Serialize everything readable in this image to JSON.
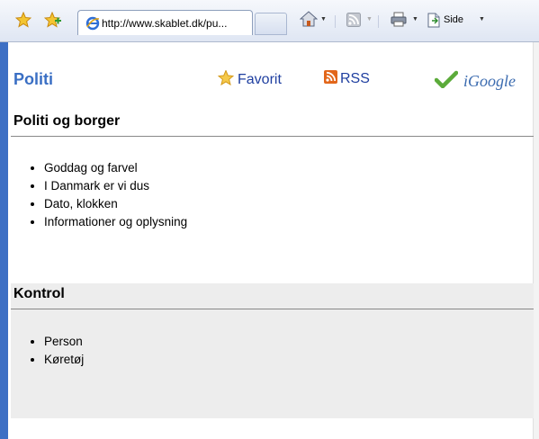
{
  "browser": {
    "tab_title": "http://www.skablet.dk/pu...",
    "page_menu_label": "Side",
    "icons": {
      "favorites": "star-icon",
      "add_favorites": "add-favorite-icon",
      "home": "home-icon",
      "feeds": "feeds-icon",
      "print": "print-icon",
      "page": "page-icon"
    }
  },
  "page": {
    "title": "Politi",
    "links": {
      "favorite": "Favorit",
      "rss": "RSS",
      "igoogle": "iGoogle"
    },
    "sections": [
      {
        "title": "Politi og borger",
        "items": [
          "Goddag og farvel",
          "I Danmark er vi dus",
          "Dato, klokken",
          "Informationer og oplysning"
        ]
      },
      {
        "title": "Kontrol",
        "items": [
          "Person",
          "Køretøj"
        ]
      }
    ]
  },
  "colors": {
    "title_blue": "#3a6fc4",
    "link_blue": "#1f3fa0",
    "left_border": "#3d6fc4",
    "section_bg": "#ededed"
  }
}
